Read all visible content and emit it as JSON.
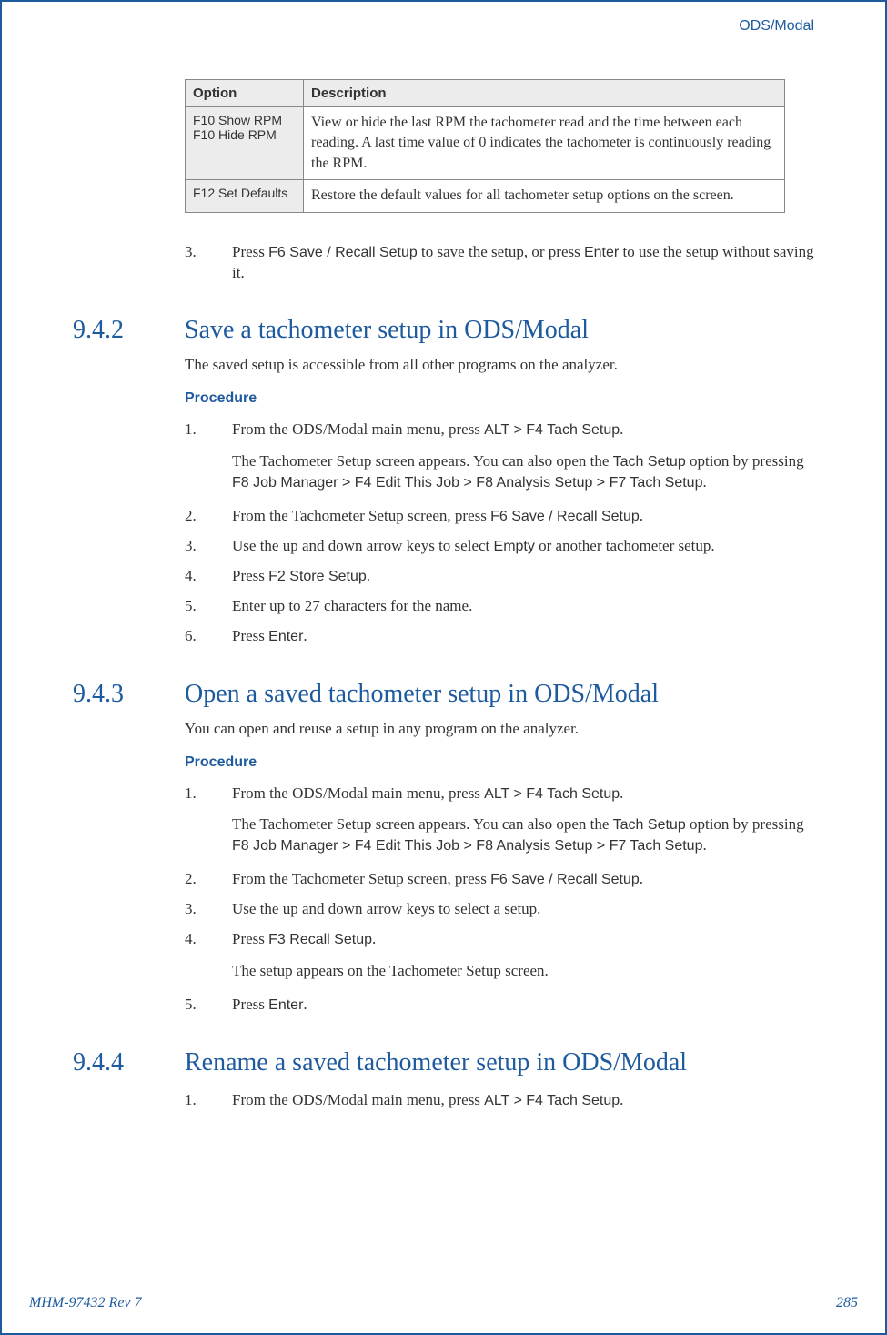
{
  "header_label": "ODS/Modal",
  "table": {
    "col1": "Option",
    "col2": "Description",
    "rows": [
      {
        "opt1": "F10 Show RPM",
        "opt2": "F10 Hide RPM",
        "desc": "View or hide the last RPM the tachometer read and the time between each reading. A last time value of 0 indicates the tachometer is continuously reading the RPM."
      },
      {
        "opt1": "F12 Set Defaults",
        "opt2": "",
        "desc": "Restore the default values for all tachometer setup options on the screen."
      }
    ]
  },
  "pre_step": {
    "n": "3.",
    "p1": "Press ",
    "k1": "F6 Save / Recall Setup",
    "p2": " to save the setup, or press ",
    "k2": "Enter",
    "p3": " to use the setup without saving it."
  },
  "s942": {
    "num": "9.4.2",
    "title": "Save a tachometer setup in ODS/Modal",
    "intro": "The saved setup is accessible from all other programs on the analyzer.",
    "proc": "Procedure",
    "step1": {
      "p1": "From the ODS/Modal main menu, press ",
      "k1": "ALT > F4 Tach Setup",
      "p2": "."
    },
    "step1_sub": {
      "p1": "The Tachometer Setup screen appears. You can also open the ",
      "k1": "Tach Setup",
      "p2": " option by pressing ",
      "k2": "F8 Job Manager > F4 Edit This Job > F8 Analysis Setup > F7 Tach Setup",
      "p3": "."
    },
    "step2": {
      "p1": "From the Tachometer Setup screen, press ",
      "k1": "F6 Save / Recall Setup",
      "p2": "."
    },
    "step3": {
      "p1": "Use the up and down arrow keys to select ",
      "k1": "Empty",
      "p2": " or another tachometer setup."
    },
    "step4": {
      "p1": "Press ",
      "k1": "F2 Store Setup",
      "p2": "."
    },
    "step5": "Enter up to 27 characters for the name.",
    "step6": {
      "p1": "Press ",
      "k1": "Enter",
      "p2": "."
    }
  },
  "s943": {
    "num": "9.4.3",
    "title": "Open a saved tachometer setup in ODS/Modal",
    "intro": "You can open and reuse a setup in any program on the analyzer.",
    "proc": "Procedure",
    "step1": {
      "p1": "From the ODS/Modal main menu, press ",
      "k1": "ALT > F4 Tach Setup",
      "p2": "."
    },
    "step1_sub": {
      "p1": "The Tachometer Setup screen appears. You can also open the ",
      "k1": "Tach Setup",
      "p2": " option by pressing ",
      "k2": "F8 Job Manager > F4 Edit This Job > F8 Analysis Setup > F7 Tach Setup",
      "p3": "."
    },
    "step2": {
      "p1": "From the Tachometer Setup screen, press ",
      "k1": "F6 Save / Recall Setup",
      "p2": "."
    },
    "step3": "Use the up and down arrow keys to select a setup.",
    "step4": {
      "p1": "Press ",
      "k1": "F3 Recall Setup",
      "p2": "."
    },
    "step4_sub": "The setup appears on the Tachometer Setup screen.",
    "step5": {
      "p1": "Press ",
      "k1": "Enter",
      "p2": "."
    }
  },
  "s944": {
    "num": "9.4.4",
    "title": "Rename a saved tachometer setup in ODS/Modal",
    "step1": {
      "p1": "From the ODS/Modal main menu, press ",
      "k1": "ALT > F4 Tach Setup",
      "p2": "."
    }
  },
  "footer": {
    "left": "MHM-97432 Rev 7",
    "right": "285"
  }
}
